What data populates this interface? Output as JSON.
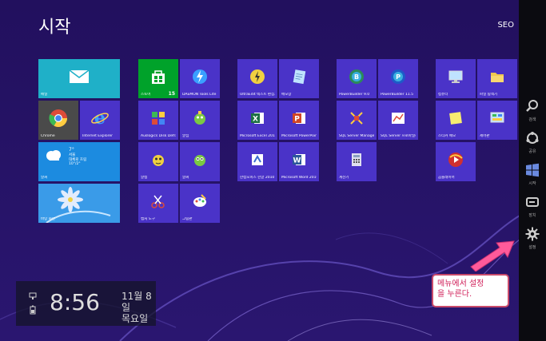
{
  "header": {
    "title": "시작",
    "user": "SEO"
  },
  "tiles": [
    {
      "id": "mail",
      "label": "메일",
      "color": "#1fb0c8",
      "icon": "mail-icon"
    },
    {
      "id": "chrome",
      "label": "Chrome",
      "color": "#4a4a4a",
      "icon": "chrome-icon"
    },
    {
      "id": "ie",
      "label": "Internet Explorer",
      "color": "#4a33c8",
      "icon": "ie-icon"
    },
    {
      "id": "weather",
      "label": "날씨",
      "color": "#1c8be0",
      "icon": "weather-icon",
      "temp": "7°",
      "city": "서울",
      "cond": "대체로 흐림",
      "range": "10°/2°"
    },
    {
      "id": "desktop",
      "label": "바탕 화면",
      "color": "#3a9be8",
      "icon": "desktop-flower-icon"
    },
    {
      "id": "store",
      "label": "스토어",
      "color": "#00a22a",
      "icon": "store-icon",
      "badge": "15"
    },
    {
      "id": "daemon",
      "label": "DAEMON Tools Lite",
      "color": "#4a33c8",
      "icon": "daemon-icon"
    },
    {
      "id": "auslogics",
      "label": "Auslogics Disk Defrag",
      "color": "#4a33c8",
      "icon": "defrag-icon"
    },
    {
      "id": "alzip",
      "label": "알집",
      "color": "#4a33c8",
      "icon": "alzip-icon"
    },
    {
      "id": "algap",
      "label": "알캡",
      "color": "#4a33c8",
      "icon": "alcap-icon"
    },
    {
      "id": "alsee",
      "label": "알씨",
      "color": "#4a33c8",
      "icon": "alsee-icon"
    },
    {
      "id": "paint",
      "label": "캡처 도구",
      "color": "#4a33c8",
      "icon": "snipping-icon"
    },
    {
      "id": "draw",
      "label": "그림판",
      "color": "#4a33c8",
      "icon": "paint-icon"
    },
    {
      "id": "ultraedit",
      "label": "UltraEdit 텍스트 편집기",
      "color": "#4a33c8",
      "icon": "ultraedit-icon"
    },
    {
      "id": "notepad",
      "label": "메모장",
      "color": "#4a33c8",
      "icon": "notepad-icon"
    },
    {
      "id": "excel",
      "label": "Microsoft Excel 2010",
      "color": "#4a33c8",
      "icon": "excel-icon"
    },
    {
      "id": "ppt",
      "label": "Microsoft PowerPoint 2010",
      "color": "#4a33c8",
      "icon": "powerpoint-icon"
    },
    {
      "id": "hangul",
      "label": "한컴오피스 한글 2010",
      "color": "#4a33c8",
      "icon": "hangul-icon"
    },
    {
      "id": "word",
      "label": "Microsoft Word 2010",
      "color": "#4a33c8",
      "icon": "word-icon"
    },
    {
      "id": "pb1",
      "label": "PowerBuilder 9.0",
      "color": "#4a33c8",
      "icon": "powerbuilder-icon"
    },
    {
      "id": "pb2",
      "label": "PowerBuilder 11.5",
      "color": "#4a33c8",
      "icon": "powerbuilder-icon"
    },
    {
      "id": "sqlmgmt",
      "label": "SQL Server Management ...",
      "color": "#4a33c8",
      "icon": "sql-icon"
    },
    {
      "id": "sqlprof",
      "label": "SQL Server 프로파일러",
      "color": "#4a33c8",
      "icon": "sql-profiler-icon"
    },
    {
      "id": "calc",
      "label": "계산기",
      "color": "#4a33c8",
      "icon": "calculator-icon"
    },
    {
      "id": "computer",
      "label": "컴퓨터",
      "color": "#4a33c8",
      "icon": "computer-icon"
    },
    {
      "id": "explorer",
      "label": "파일 탐색기",
      "color": "#4a33c8",
      "icon": "folder-icon"
    },
    {
      "id": "sticky",
      "label": "스티커 메모",
      "color": "#4a33c8",
      "icon": "sticky-icon"
    },
    {
      "id": "control",
      "label": "제어판",
      "color": "#4a33c8",
      "icon": "control-panel-icon"
    },
    {
      "id": "potplayer",
      "label": "곰플레이어",
      "color": "#4a33c8",
      "icon": "player-icon"
    }
  ],
  "charms": [
    {
      "id": "search",
      "label": "검색",
      "icon": "search-icon"
    },
    {
      "id": "share",
      "label": "공유",
      "icon": "share-icon"
    },
    {
      "id": "start",
      "label": "시작",
      "icon": "windows-icon"
    },
    {
      "id": "devices",
      "label": "장치",
      "icon": "devices-icon"
    },
    {
      "id": "settings",
      "label": "설정",
      "icon": "gear-icon"
    }
  ],
  "clock": {
    "time": "8:56",
    "date": "11월 8일",
    "day": "목요일"
  },
  "callout": {
    "line1": "메뉴에서 설정",
    "line2": "을 누른다."
  }
}
